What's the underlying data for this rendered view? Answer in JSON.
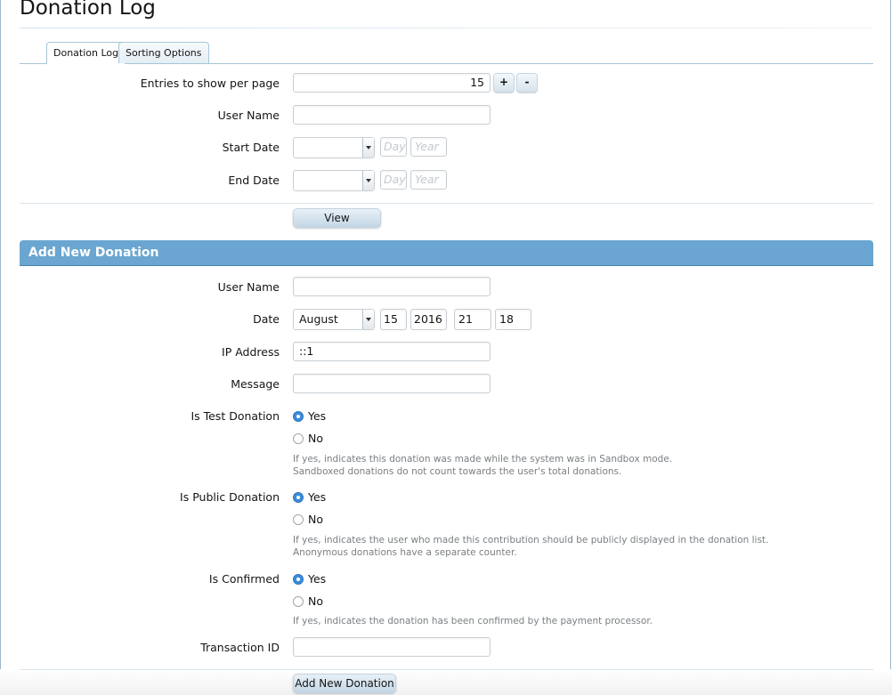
{
  "page": {
    "title": "Donation Log"
  },
  "tabs": [
    {
      "label": "Donation Log",
      "active": true
    },
    {
      "label": "Sorting Options",
      "active": false
    }
  ],
  "filter": {
    "entries_label": "Entries to show per page",
    "entries_value": "15",
    "plus_label": "+",
    "minus_label": "-",
    "username_label": "User Name",
    "username_value": "",
    "start_date_label": "Start Date",
    "end_date_label": "End Date",
    "day_placeholder": "Day",
    "year_placeholder": "Year",
    "view_button": "View"
  },
  "add": {
    "header": "Add New Donation",
    "username_label": "User Name",
    "username_value": "",
    "date_label": "Date",
    "month": "August",
    "day": "15",
    "year": "2016",
    "hour": "21",
    "minute": "18",
    "ip_label": "IP Address",
    "ip_value": "::1",
    "message_label": "Message",
    "message_value": "",
    "test_label": "Is Test Donation",
    "test_hint_1": "If yes, indicates this donation was made while the system was in Sandbox mode.",
    "test_hint_2": "Sandboxed donations do not count towards the user's total donations.",
    "public_label": "Is Public Donation",
    "public_hint_1": "If yes, indicates the user who made this contribution should be publicly displayed in the donation list.",
    "public_hint_2": "Anonymous donations have a separate counter.",
    "confirmed_label": "Is Confirmed",
    "confirmed_hint": "If yes, indicates the donation has been confirmed by the payment processor.",
    "yes_label": "Yes",
    "no_label": "No",
    "txn_label": "Transaction ID",
    "txn_value": "",
    "submit_button": "Add New Donation"
  },
  "colors": {
    "section_header": "#6aa6d1",
    "radio_checked": "#3b8ddc"
  }
}
